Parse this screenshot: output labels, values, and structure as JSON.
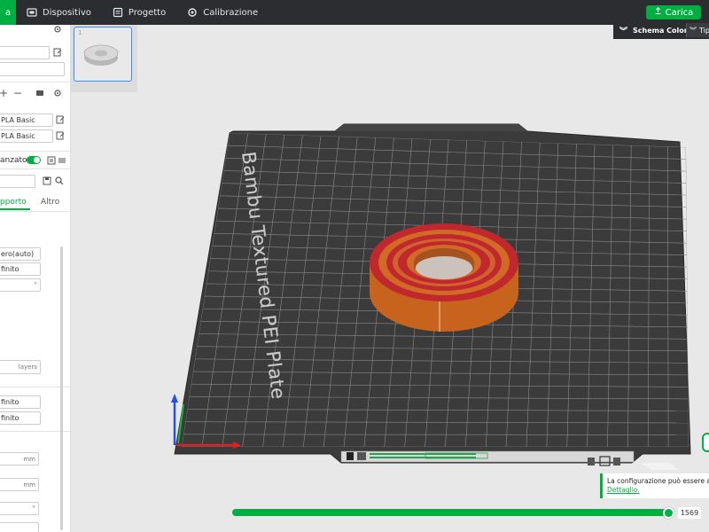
{
  "topbar": {
    "tabs": [
      {
        "label": "a",
        "icon": "prepare-icon",
        "active": true
      },
      {
        "label": "Dispositivo",
        "icon": "device-icon"
      },
      {
        "label": "Progetto",
        "icon": "project-icon"
      },
      {
        "label": "Calibrazione",
        "icon": "calibration-icon"
      }
    ],
    "carica_label": "Carica"
  },
  "left_panel": {
    "filaments": [
      "PLA Basic",
      "PLA Basic"
    ],
    "advanced_label": "anzato",
    "tabs": [
      "pporto",
      "Altro"
    ],
    "support_type": "ero(auto)",
    "support_style": "finito",
    "layers_unit": "layers",
    "interface_pattern_1": "finito",
    "interface_pattern_2": "finito",
    "unit_mm_1": "mm",
    "unit_mm_2": "mm"
  },
  "plate_thumb": {
    "number": "1"
  },
  "scheme_bar": {
    "label": "Schema Colore",
    "type_label": "Tip"
  },
  "bed": {
    "label": "Bambu Textured PEI Plate"
  },
  "notification": {
    "text": "La configurazione può essere agg",
    "link": "Dettaglio."
  },
  "layer_slider": {
    "value": "1569",
    "fraction": 1.0
  },
  "colors": {
    "accent": "#00ae42",
    "model_orange": "#d2691e",
    "model_red": "#c0282d",
    "bed": "#3c3c3c"
  }
}
